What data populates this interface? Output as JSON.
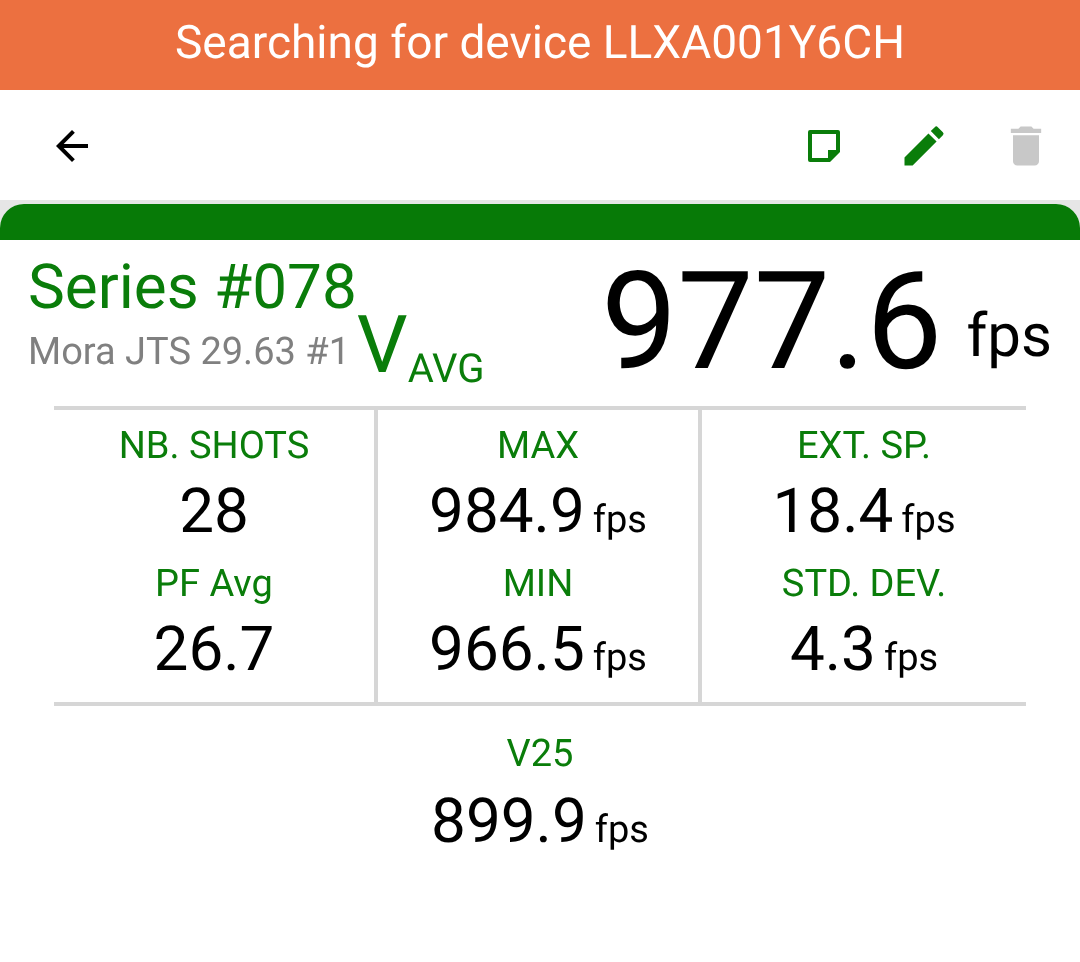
{
  "banner": {
    "text": "Searching for device LLXA001Y6CH"
  },
  "toolbar": {
    "actions": [
      {
        "kind": "note",
        "disabled": false
      },
      {
        "kind": "edit",
        "disabled": false
      },
      {
        "kind": "delete",
        "disabled": true
      }
    ]
  },
  "series": {
    "title": "Series #078",
    "subtitle": "Mora JTS 29.63 #1",
    "avg_label": "V$_{AVG}$",
    "avg_value": "977.6",
    "avg_unit": "fps"
  },
  "stats": [
    {
      "label": "NB. SHOTS",
      "value": "28"
    },
    {
      "label": "MAX",
      "value": "984.9",
      "unit": "fps"
    },
    {
      "label": "EXT. SP.",
      "value": "18.4",
      "unit": "fps"
    },
    {
      "label": "PF Avg",
      "value": "26.7"
    },
    {
      "label": "MIN",
      "value": "966.5",
      "unit": "fps"
    },
    {
      "label": "STD. DEV.",
      "value": "4.3",
      "unit": "fps"
    }
  ],
  "v25": {
    "label": "V25",
    "value": "899.9",
    "unit": "fps"
  }
}
